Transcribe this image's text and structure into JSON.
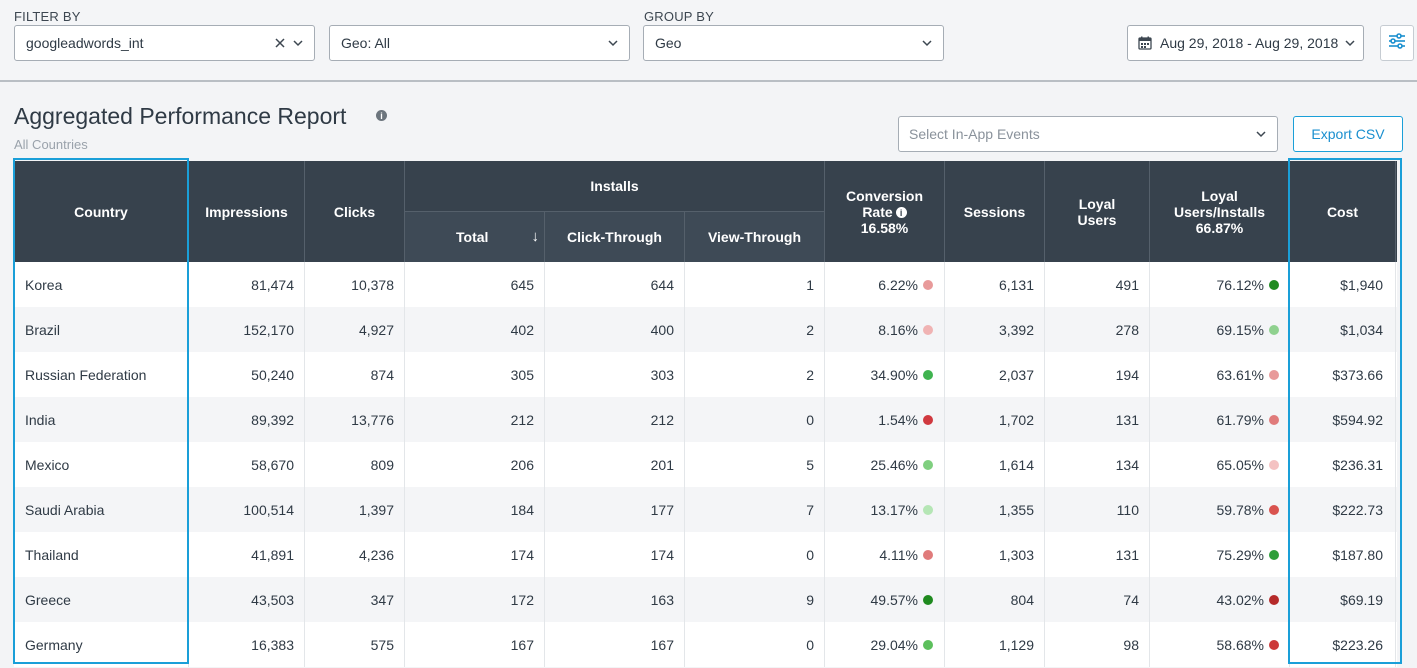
{
  "filters": {
    "filter_by_label": "FILTER BY",
    "source_value": "googleadwords_int",
    "geo_value": "Geo: All",
    "group_by_label": "GROUP BY",
    "group_value": "Geo",
    "date_range": "Aug 29, 2018 - Aug 29, 2018"
  },
  "report": {
    "title": "Aggregated Performance Report",
    "subtitle": "All Countries",
    "events_placeholder": "Select In-App Events",
    "export_label": "Export CSV"
  },
  "table": {
    "headers": {
      "country": "Country",
      "impressions": "Impressions",
      "clicks": "Clicks",
      "installs": "Installs",
      "total": "Total",
      "sort_arrow": "↓",
      "click_through": "Click-Through",
      "view_through": "View-Through",
      "conversion_line1": "Conversion",
      "conversion_line2": "Rate",
      "conversion_total": "16.58%",
      "sessions": "Sessions",
      "loyal_users_line1": "Loyal",
      "loyal_users_line2": "Users",
      "loyal_ratio_line1": "Loyal",
      "loyal_ratio_line2": "Users/Installs",
      "loyal_ratio_total": "66.87%",
      "cost": "Cost"
    },
    "rows": [
      {
        "country": "Korea",
        "impressions": "81,474",
        "clicks": "10,378",
        "total": "645",
        "click_through": "644",
        "view_through": "1",
        "conversion": "6.22%",
        "conv_color": "#e89a9a",
        "sessions": "6,131",
        "loyal_users": "491",
        "loyal_ratio": "76.12%",
        "loyal_color": "#1f8a1f",
        "cost": "$1,940"
      },
      {
        "country": "Brazil",
        "impressions": "152,170",
        "clicks": "4,927",
        "total": "402",
        "click_through": "400",
        "view_through": "2",
        "conversion": "8.16%",
        "conv_color": "#f0b3b3",
        "sessions": "3,392",
        "loyal_users": "278",
        "loyal_ratio": "69.15%",
        "loyal_color": "#8fd18f",
        "cost": "$1,034"
      },
      {
        "country": "Russian Federation",
        "impressions": "50,240",
        "clicks": "874",
        "total": "305",
        "click_through": "303",
        "view_through": "2",
        "conversion": "34.90%",
        "conv_color": "#3fb34f",
        "sessions": "2,037",
        "loyal_users": "194",
        "loyal_ratio": "63.61%",
        "loyal_color": "#e89a9a",
        "cost": "$373.66"
      },
      {
        "country": "India",
        "impressions": "89,392",
        "clicks": "13,776",
        "total": "212",
        "click_through": "212",
        "view_through": "0",
        "conversion": "1.54%",
        "conv_color": "#d0393f",
        "sessions": "1,702",
        "loyal_users": "131",
        "loyal_ratio": "61.79%",
        "loyal_color": "#e07b7b",
        "cost": "$594.92"
      },
      {
        "country": "Mexico",
        "impressions": "58,670",
        "clicks": "809",
        "total": "206",
        "click_through": "201",
        "view_through": "5",
        "conversion": "25.46%",
        "conv_color": "#7fcf7f",
        "sessions": "1,614",
        "loyal_users": "134",
        "loyal_ratio": "65.05%",
        "loyal_color": "#f4c2c2",
        "cost": "$236.31"
      },
      {
        "country": "Saudi Arabia",
        "impressions": "100,514",
        "clicks": "1,397",
        "total": "184",
        "click_through": "177",
        "view_through": "7",
        "conversion": "13.17%",
        "conv_color": "#b5e6b5",
        "sessions": "1,355",
        "loyal_users": "110",
        "loyal_ratio": "59.78%",
        "loyal_color": "#d9534f",
        "cost": "$222.73"
      },
      {
        "country": "Thailand",
        "impressions": "41,891",
        "clicks": "4,236",
        "total": "174",
        "click_through": "174",
        "view_through": "0",
        "conversion": "4.11%",
        "conv_color": "#e07b7b",
        "sessions": "1,303",
        "loyal_users": "131",
        "loyal_ratio": "75.29%",
        "loyal_color": "#2e9e3a",
        "cost": "$187.80"
      },
      {
        "country": "Greece",
        "impressions": "43,503",
        "clicks": "347",
        "total": "172",
        "click_through": "163",
        "view_through": "9",
        "conversion": "49.57%",
        "conv_color": "#1f8a1f",
        "sessions": "804",
        "loyal_users": "74",
        "loyal_ratio": "43.02%",
        "loyal_color": "#b52a2a",
        "cost": "$69.19"
      },
      {
        "country": "Germany",
        "impressions": "16,383",
        "clicks": "575",
        "total": "167",
        "click_through": "167",
        "view_through": "0",
        "conversion": "29.04%",
        "conv_color": "#5cbf5c",
        "sessions": "1,129",
        "loyal_users": "98",
        "loyal_ratio": "58.68%",
        "loyal_color": "#cc3a3a",
        "cost": "$223.26"
      }
    ]
  },
  "colors": {
    "header_bg": "#37424d",
    "accent": "#1a9fd8"
  }
}
